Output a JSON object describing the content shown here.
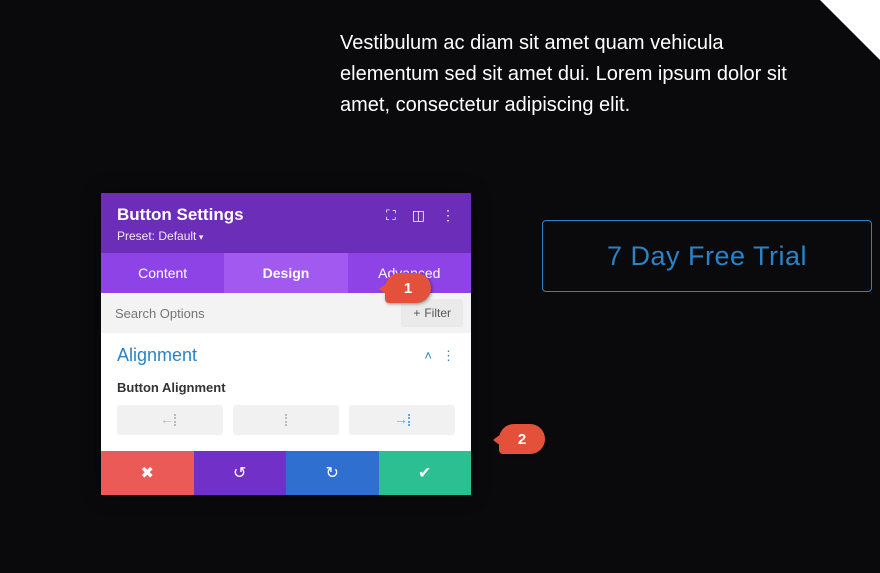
{
  "intro_text": "Vestibulum ac diam sit amet quam vehicula elementum sed sit amet dui. Lorem ipsum dolor sit amet, consectetur adipiscing elit.",
  "trial_button": "7 Day Free Trial",
  "callouts": {
    "one": "1",
    "two": "2"
  },
  "modal": {
    "title": "Button Settings",
    "preset": "Preset: Default",
    "tabs": {
      "content": "Content",
      "design": "Design",
      "advanced": "Advanced",
      "active": "design"
    },
    "search": {
      "placeholder": "Search Options",
      "filter_label": "Filter"
    },
    "section": {
      "title": "Alignment",
      "field_label": "Button Alignment"
    },
    "alignment_selected": "right",
    "footer_icons": {
      "cancel": "✖",
      "undo": "↺",
      "redo": "↻",
      "confirm": "✔"
    }
  }
}
